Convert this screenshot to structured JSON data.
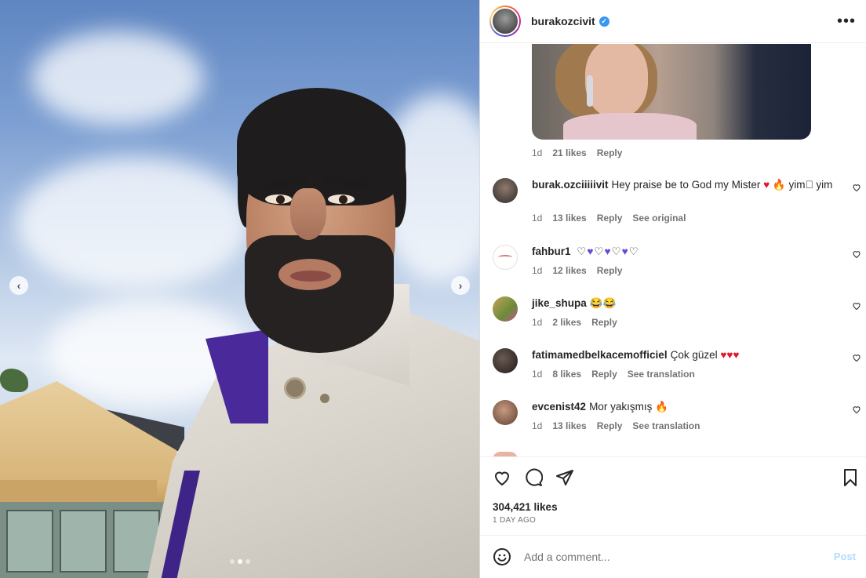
{
  "post": {
    "carousel": {
      "total_slides": 3,
      "active_slide": 2
    }
  },
  "header": {
    "username": "burakozcivit",
    "verified_icon": "✓",
    "more_icon": "•••"
  },
  "first_comment_meta": {
    "time": "1d",
    "likes": "21 likes",
    "reply": "Reply"
  },
  "comments": [
    {
      "username": "burak.ozciiiiivit",
      "text": "Hey praise be to God my Mister",
      "extra": "yim⃞ yim",
      "time": "1d",
      "likes": "13 likes",
      "reply": "Reply",
      "action": "See original"
    },
    {
      "username": "fahbur1",
      "text": "",
      "time": "1d",
      "likes": "12 likes",
      "reply": "Reply",
      "action": ""
    },
    {
      "username": "jike_shupa",
      "text": "😂😂",
      "time": "1d",
      "likes": "2 likes",
      "reply": "Reply",
      "action": ""
    },
    {
      "username": "fatimamedbelkacemofficiel",
      "text": "Çok güzel",
      "time": "1d",
      "likes": "8 likes",
      "reply": "Reply",
      "action": "See translation"
    },
    {
      "username": "evcenist42",
      "text": "Mor yakışmış",
      "time": "1d",
      "likes": "13 likes",
      "reply": "Reply",
      "action": "See translation"
    }
  ],
  "footer": {
    "likes": "304,421 likes",
    "date": "1 DAY AGO",
    "comment_placeholder": "Add a comment...",
    "post_label": "Post"
  }
}
